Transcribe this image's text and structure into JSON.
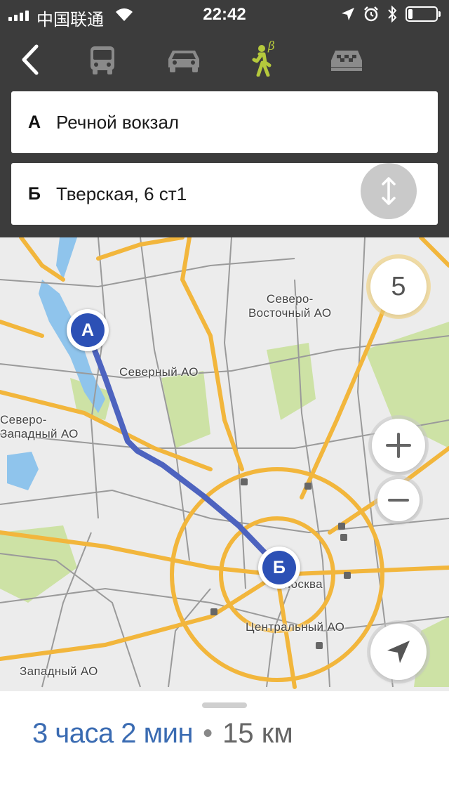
{
  "status_bar": {
    "carrier": "中国联通",
    "time": "22:42",
    "icons": [
      "signal-icon",
      "wifi-icon",
      "location-arrow-icon",
      "alarm-icon",
      "bluetooth-icon",
      "battery-icon"
    ],
    "battery_level": 0.15
  },
  "header": {
    "back_icon": "chevron-left-icon",
    "transport_modes": [
      {
        "name": "bus",
        "icon": "bus-icon",
        "selected": false
      },
      {
        "name": "car",
        "icon": "car-icon",
        "selected": false
      },
      {
        "name": "walk",
        "icon": "walking-icon",
        "selected": true,
        "badge": "β"
      },
      {
        "name": "taxi",
        "icon": "taxi-icon",
        "selected": false
      }
    ],
    "from": {
      "letter": "А",
      "value": "Речной вокзал"
    },
    "to": {
      "letter": "Б",
      "value": "Тверская, 6 ст1"
    },
    "swap_icon": "swap-vertical-icon"
  },
  "map": {
    "labels": {
      "north_east": "Северо-\nВосточный АО",
      "north": "Северный АО",
      "north_west": "Северо-\nЗападный АО",
      "center": "Центральный АО",
      "west": "Западный АО",
      "moskva": "Москва"
    },
    "marker_start": "А",
    "marker_end": "Б",
    "zoom_level": "5",
    "controls": {
      "zoom_in_icon": "plus-icon",
      "zoom_out_icon": "minus-icon",
      "locate_icon": "navigation-arrow-icon"
    },
    "colors": {
      "route": "#4d63bf",
      "major_road": "#f2b63c",
      "water": "#8fc4ec",
      "park": "#cde2a5",
      "marker": "#2c50b5"
    }
  },
  "route": {
    "duration": "3 часа 2 мин",
    "separator": "•",
    "distance": "15 км"
  },
  "colors": {
    "header_bg": "#3c3c3c",
    "accent_selected": "#b5c93c",
    "icon_inactive": "#8a8a8a",
    "duration_text": "#3a6bb2"
  }
}
